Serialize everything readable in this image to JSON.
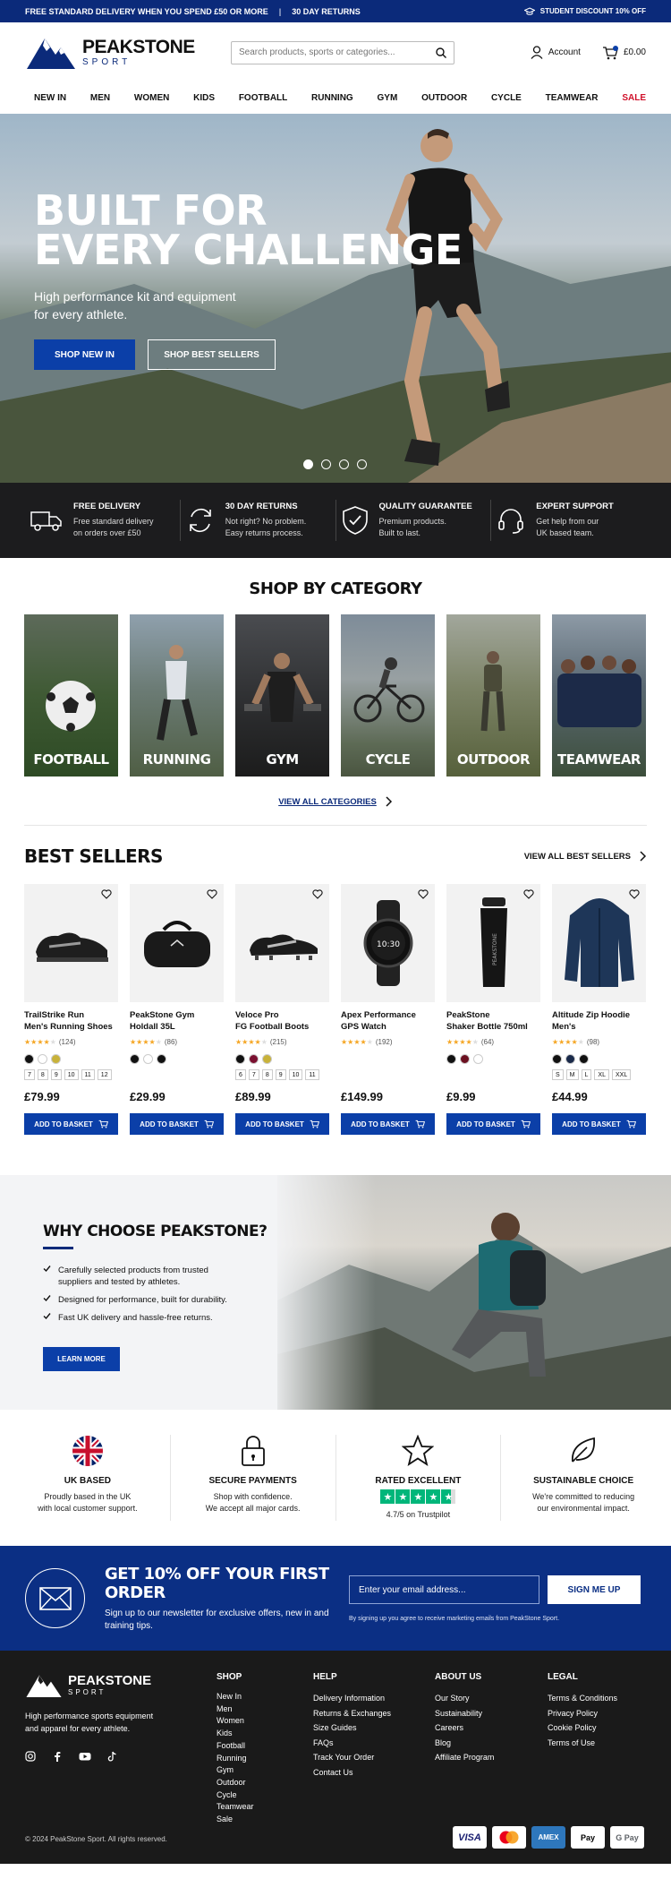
{
  "topbar": {
    "left1": "FREE STANDARD DELIVERY WHEN YOU SPEND £50 OR MORE",
    "sep": "|",
    "left2": "30 DAY RETURNS",
    "right": "STUDENT DISCOUNT 10% OFF"
  },
  "header": {
    "brand": "PEAKSTONE",
    "brand_sub": "SPORT",
    "search_placeholder": "Search products, sports or categories...",
    "account": "Account",
    "basket": "£0.00"
  },
  "nav": [
    "NEW IN",
    "MEN",
    "WOMEN",
    "KIDS",
    "FOOTBALL",
    "RUNNING",
    "GYM",
    "OUTDOOR",
    "CYCLE",
    "TEAMWEAR",
    "SALE"
  ],
  "hero": {
    "line1": "BUILT FOR",
    "line2": "EVERY CHALLENGE",
    "sub": "High performance kit and equipment for every athlete.",
    "cta1": "SHOP NEW IN",
    "cta2": "SHOP BEST SELLERS"
  },
  "features": [
    {
      "title": "FREE DELIVERY",
      "d1": "Free standard delivery",
      "d2": "on orders over £50",
      "icon": "truck-icon"
    },
    {
      "title": "30 DAY RETURNS",
      "d1": "Not right? No problem.",
      "d2": "Easy returns process.",
      "icon": "returns-icon"
    },
    {
      "title": "QUALITY GUARANTEE",
      "d1": "Premium products.",
      "d2": "Built to last.",
      "icon": "shield-icon"
    },
    {
      "title": "EXPERT SUPPORT",
      "d1": "Get help from our",
      "d2": "UK based team.",
      "icon": "headset-icon"
    }
  ],
  "categories": {
    "title": "SHOP BY CATEGORY",
    "items": [
      "FOOTBALL",
      "RUNNING",
      "GYM",
      "CYCLE",
      "OUTDOOR",
      "TEAMWEAR"
    ],
    "view_all": "VIEW ALL CATEGORIES"
  },
  "bestsellers": {
    "title": "BEST SELLERS",
    "view_all": "VIEW ALL BEST SELLERS",
    "add_label": "ADD TO BASKET",
    "products": [
      {
        "name1": "TrailStrike Run",
        "name2": "Men's Running Shoes",
        "rating": 4.5,
        "reviews": "(124)",
        "swatches": [
          "#111111",
          "#ffffff",
          "#c8b23a"
        ],
        "sizes": [
          "7",
          "8",
          "9",
          "10",
          "11",
          "12"
        ],
        "price": "£79.99"
      },
      {
        "name1": "PeakStone Gym",
        "name2": "Holdall 35L",
        "rating": 4.5,
        "reviews": "(86)",
        "swatches": [
          "#111111",
          "#ffffff",
          "#111111"
        ],
        "sizes": [],
        "price": "£29.99"
      },
      {
        "name1": "Veloce Pro",
        "name2": "FG Football Boots",
        "rating": 4.5,
        "reviews": "(215)",
        "swatches": [
          "#111111",
          "#7a1030",
          "#c8b23a"
        ],
        "sizes": [
          "6",
          "7",
          "8",
          "9",
          "10",
          "11"
        ],
        "price": "£89.99"
      },
      {
        "name1": "Apex Performance",
        "name2": "GPS Watch",
        "rating": 4.5,
        "reviews": "(192)",
        "swatches": [],
        "sizes": [],
        "price": "£149.99"
      },
      {
        "name1": "PeakStone",
        "name2": "Shaker Bottle 750ml",
        "rating": 4.5,
        "reviews": "(64)",
        "swatches": [
          "#111111",
          "#6b1020",
          "#ffffff"
        ],
        "sizes": [],
        "price": "£9.99"
      },
      {
        "name1": "Altitude Zip Hoodie",
        "name2": "Men's",
        "rating": 4.5,
        "reviews": "(98)",
        "swatches": [
          "#111111",
          "#1a2a4a",
          "#111111"
        ],
        "sizes": [
          "S",
          "M",
          "L",
          "XL",
          "XXL"
        ],
        "price": "£44.99"
      }
    ]
  },
  "why": {
    "title": "WHY CHOOSE PEAKSTONE?",
    "points": [
      [
        "Carefully selected products from trusted",
        "suppliers and tested by athletes."
      ],
      [
        "Designed for performance, built for durability."
      ],
      [
        "Fast UK delivery and hassle-free returns."
      ]
    ],
    "cta": "LEARN MORE"
  },
  "trust": [
    {
      "title": "UK BASED",
      "d1": "Proudly based in the UK",
      "d2": "with local customer support.",
      "icon": "uk-flag-icon"
    },
    {
      "title": "SECURE PAYMENTS",
      "d1": "Shop with confidence.",
      "d2": "We accept all major cards.",
      "icon": "lock-icon"
    },
    {
      "title": "RATED EXCELLENT",
      "d1": "4.7/5 on Trustpilot",
      "d2": "",
      "icon": "star-icon"
    },
    {
      "title": "SUSTAINABLE CHOICE",
      "d1": "We're committed to reducing",
      "d2": "our environmental impact.",
      "icon": "leaf-icon"
    }
  ],
  "newsletter": {
    "title": "GET 10% OFF YOUR FIRST ORDER",
    "sub": "Sign up to our newsletter for exclusive offers, new in and training tips.",
    "placeholder": "Enter your email address...",
    "button": "SIGN ME UP",
    "small": "By signing up you agree to receive marketing emails from PeakStone Sport."
  },
  "footer": {
    "brand": "PEAKSTONE",
    "brand_sub": "SPORT",
    "tagline": "High performance sports equipment and apparel for every athlete.",
    "shop": {
      "title": "SHOP",
      "items": [
        "New In",
        "Men",
        "Women",
        "Kids",
        "Football",
        "Running",
        "Gym",
        "Outdoor",
        "Cycle",
        "Teamwear",
        "Sale"
      ]
    },
    "help": {
      "title": "HELP",
      "items": [
        "Delivery Information",
        "Returns & Exchanges",
        "Size Guides",
        "FAQs",
        "Track Your Order",
        "Contact Us"
      ]
    },
    "about": {
      "title": "ABOUT US",
      "items": [
        "Our Story",
        "Sustainability",
        "Careers",
        "Blog",
        "Affiliate Program"
      ]
    },
    "legal": {
      "title": "LEGAL",
      "items": [
        "Terms & Conditions",
        "Privacy Policy",
        "Cookie Policy",
        "Terms of Use"
      ]
    },
    "copyright": "© 2024 PeakStone Sport. All rights reserved.",
    "payments": [
      "VISA",
      "Mastercard",
      "AMEX",
      "Apple Pay",
      "G Pay"
    ]
  },
  "colors": {
    "brand": "#0b2a7a",
    "cta": "#0b3fa8",
    "sale": "#d0102a",
    "trustpilot": "#00b67a",
    "star": "#f5a623"
  }
}
